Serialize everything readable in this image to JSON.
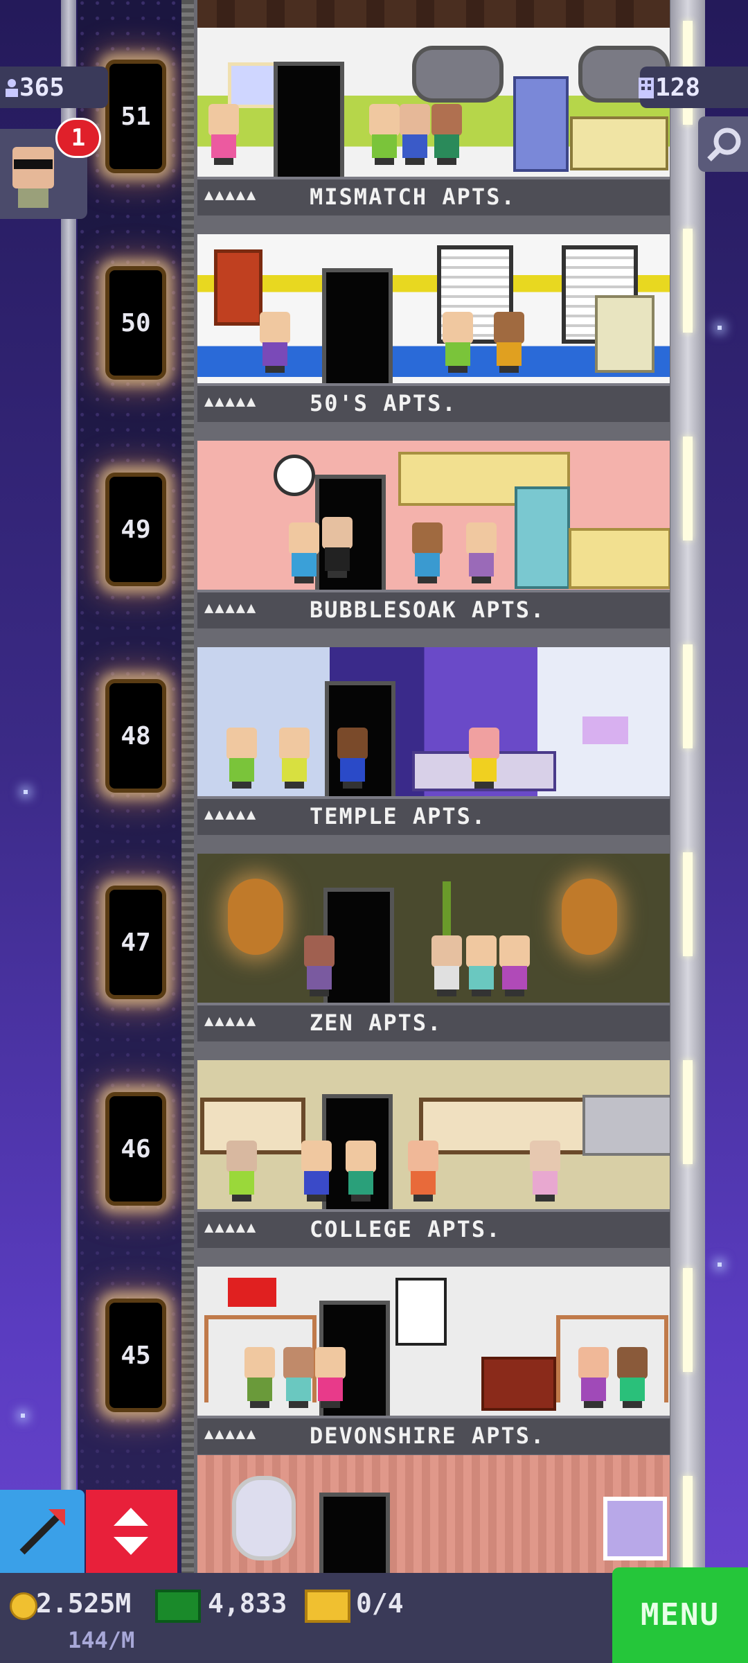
{
  "hud": {
    "population": "365",
    "floors_count": "128",
    "visitor_badge": "1"
  },
  "floors": [
    {
      "number": "51",
      "name": "MISMATCH APTS."
    },
    {
      "number": "50",
      "name": "50'S APTS."
    },
    {
      "number": "49",
      "name": "BUBBLESOAK APTS."
    },
    {
      "number": "48",
      "name": "TEMPLE APTS."
    },
    {
      "number": "47",
      "name": "ZEN APTS."
    },
    {
      "number": "46",
      "name": "COLLEGE APTS."
    },
    {
      "number": "45",
      "name": "DEVONSHIRE APTS."
    }
  ],
  "resident_icons": "▲▲▲▲▲",
  "economy": {
    "coins": "2.525M",
    "coins_rate": "144/M",
    "bux": "4,833",
    "tickets": "0/4"
  },
  "menu_label": "MENU",
  "colors": {
    "menu_green": "#25c63a",
    "elevator_red": "#e8203a",
    "blue_button": "#3aa0e8",
    "badge_red": "#e0202a"
  }
}
